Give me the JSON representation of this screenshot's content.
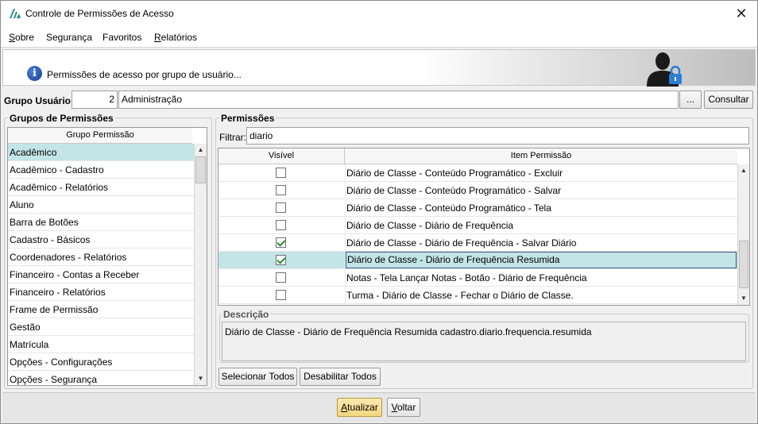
{
  "window": {
    "title": "Controle de Permissões de Acesso",
    "close_glyph": "✕"
  },
  "menu": [
    {
      "label": "Sobre"
    },
    {
      "label": "Segurança"
    },
    {
      "label": "Favoritos"
    },
    {
      "label": "Relatórios"
    }
  ],
  "banner": {
    "text": "Permissões de acesso por grupo de usuário...",
    "info_glyph": "i"
  },
  "grupo_usuario": {
    "label": "Grupo Usuário:",
    "code": "2",
    "name": "Administração",
    "ellipsis_label": "...",
    "consultar_label": "Consultar"
  },
  "grupos": {
    "legend": "Grupos de Permissões",
    "column_header": "Grupo Permissão",
    "selected_index": 0,
    "items": [
      "Acadêmico",
      "Acadêmico - Cadastro",
      "Acadêmico - Relatórios",
      "Aluno",
      "Barra de Botões",
      "Cadastro - Básicos",
      "Coordenadores - Relatórios",
      "Financeiro - Contas a Receber",
      "Financeiro - Relatórios",
      "Frame de Permissão",
      "Gestão",
      "Matrícula",
      "Opções - Configurações",
      "Opções - Segurança"
    ]
  },
  "permissoes": {
    "legend": "Permissões",
    "filter_label": "Filtrar:",
    "filter_value": "diario",
    "col_visivel": "Visível",
    "col_item": "Item Permissão",
    "selected_index": 5,
    "rows": [
      {
        "checked": false,
        "item": "Diário de Classe - Conteúdo Programático - Excluir"
      },
      {
        "checked": false,
        "item": "Diário de Classe - Conteúdo Programático - Salvar"
      },
      {
        "checked": false,
        "item": "Diário de Classe - Conteúdo Programático - Tela"
      },
      {
        "checked": false,
        "item": "Diário de Classe - Diário de Frequência"
      },
      {
        "checked": true,
        "item": "Diário de Classe - Diário de Frequência - Salvar Diário"
      },
      {
        "checked": true,
        "item": "Diário de Classe - Diário de Frequência Resumida"
      },
      {
        "checked": false,
        "item": "Notas - Tela Lançar Notas - Botão - Diário de Frequência"
      },
      {
        "checked": false,
        "item": "Turma - Diário de Classe - Fechar o Diário de Classe."
      }
    ],
    "descricao_legend": "Descrição",
    "descricao_text": "Diário de Classe - Diário de Frequência Resumida cadastro.diario.frequencia.resumida",
    "selecionar_todos": "Selecionar Todos",
    "desabilitar_todos": "Desabilitar Todos"
  },
  "footer": {
    "atualizar": "Atualizar",
    "voltar": "Voltar"
  },
  "colors": {
    "selection": "#c3e5e7",
    "check": "#2d8a2d",
    "accent_blue": "#1a3f8f"
  }
}
